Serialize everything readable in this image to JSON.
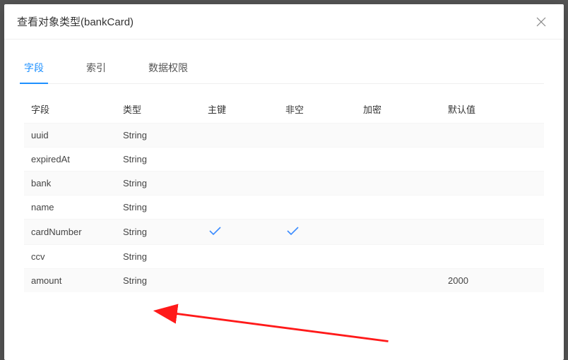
{
  "modal": {
    "title": "查看对象类型(bankCard)"
  },
  "tabs": [
    {
      "label": "字段",
      "active": true
    },
    {
      "label": "索引",
      "active": false
    },
    {
      "label": "数据权限",
      "active": false
    }
  ],
  "table": {
    "headers": {
      "field": "字段",
      "type": "类型",
      "primary": "主键",
      "notnull": "非空",
      "encrypted": "加密",
      "default": "默认值"
    },
    "rows": [
      {
        "field": "uuid",
        "type": "String",
        "primary": false,
        "notnull": false,
        "encrypted": "",
        "default": ""
      },
      {
        "field": "expiredAt",
        "type": "String",
        "primary": false,
        "notnull": false,
        "encrypted": "",
        "default": ""
      },
      {
        "field": "bank",
        "type": "String",
        "primary": false,
        "notnull": false,
        "encrypted": "",
        "default": ""
      },
      {
        "field": "name",
        "type": "String",
        "primary": false,
        "notnull": false,
        "encrypted": "",
        "default": ""
      },
      {
        "field": "cardNumber",
        "type": "String",
        "primary": true,
        "notnull": true,
        "encrypted": "",
        "default": ""
      },
      {
        "field": "ccv",
        "type": "String",
        "primary": false,
        "notnull": false,
        "encrypted": "",
        "default": ""
      },
      {
        "field": "amount",
        "type": "String",
        "primary": false,
        "notnull": false,
        "encrypted": "",
        "default": "2000"
      }
    ]
  },
  "icons": {
    "close": "close-icon",
    "check": "check-icon"
  },
  "annotation": {
    "arrow_target_row": "amount"
  }
}
